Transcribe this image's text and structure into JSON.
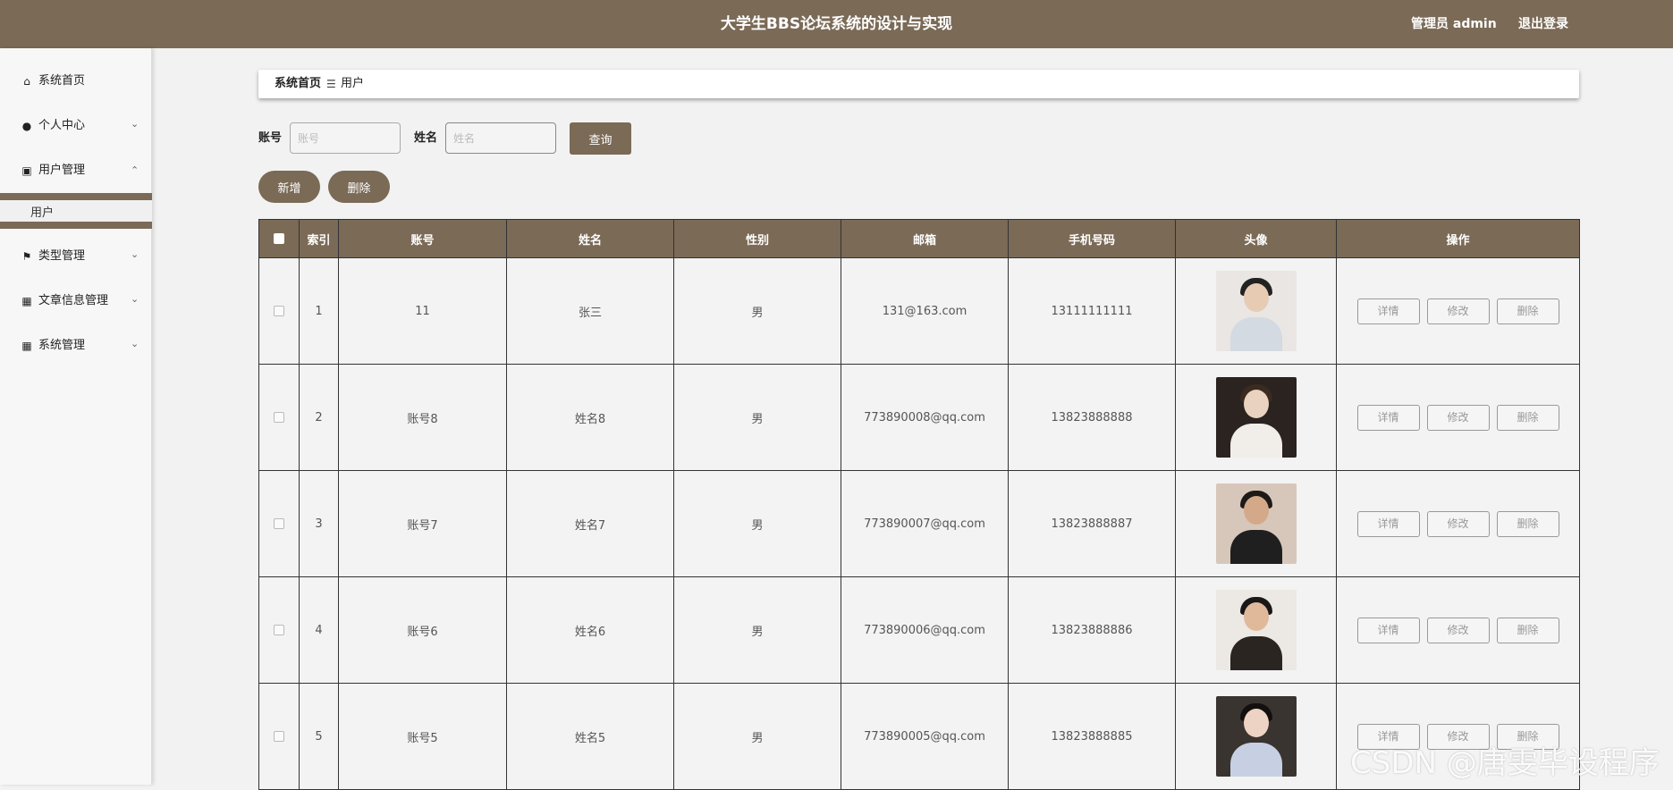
{
  "header": {
    "title": "大学生BBS论坛系统的设计与实现",
    "admin_label": "管理员 admin",
    "logout_label": "退出登录"
  },
  "sidebar": {
    "items": [
      {
        "label": "系统首页",
        "icon": "home-icon"
      },
      {
        "label": "个人中心",
        "icon": "user-icon"
      },
      {
        "label": "用户管理",
        "icon": "chart-icon"
      },
      {
        "label": "类型管理",
        "icon": "flag-icon"
      },
      {
        "label": "文章信息管理",
        "icon": "grid-icon"
      },
      {
        "label": "系统管理",
        "icon": "grid-icon"
      }
    ],
    "sub_item": "用户"
  },
  "breadcrumb": {
    "home": "系统首页",
    "separator": "☰",
    "current": "用户"
  },
  "search": {
    "account_label": "账号",
    "account_placeholder": "账号",
    "account_value": "",
    "name_label": "姓名",
    "name_placeholder": "姓名",
    "name_value": "",
    "query_button": "查询"
  },
  "actions": {
    "add": "新增",
    "delete": "删除"
  },
  "table": {
    "headers": [
      "索引",
      "账号",
      "姓名",
      "性别",
      "邮箱",
      "手机号码",
      "头像",
      "操作"
    ],
    "rows": [
      {
        "index": "1",
        "account": "11",
        "name": "张三",
        "gender": "男",
        "email": "131@163.com",
        "phone": "13111111111"
      },
      {
        "index": "2",
        "account": "账号8",
        "name": "姓名8",
        "gender": "男",
        "email": "773890008@qq.com",
        "phone": "13823888888"
      },
      {
        "index": "3",
        "account": "账号7",
        "name": "姓名7",
        "gender": "男",
        "email": "773890007@qq.com",
        "phone": "13823888887"
      },
      {
        "index": "4",
        "account": "账号6",
        "name": "姓名6",
        "gender": "男",
        "email": "773890006@qq.com",
        "phone": "13823888886"
      },
      {
        "index": "5",
        "account": "账号5",
        "name": "姓名5",
        "gender": "男",
        "email": "773890005@qq.com",
        "phone": "13823888885"
      }
    ],
    "row_buttons": {
      "detail": "详情",
      "edit": "修改",
      "delete": "删除"
    }
  },
  "watermark": "CSDN @唐雯毕设程序",
  "colors": {
    "accent": "#7a6a56",
    "background": "#f2f2f2"
  }
}
